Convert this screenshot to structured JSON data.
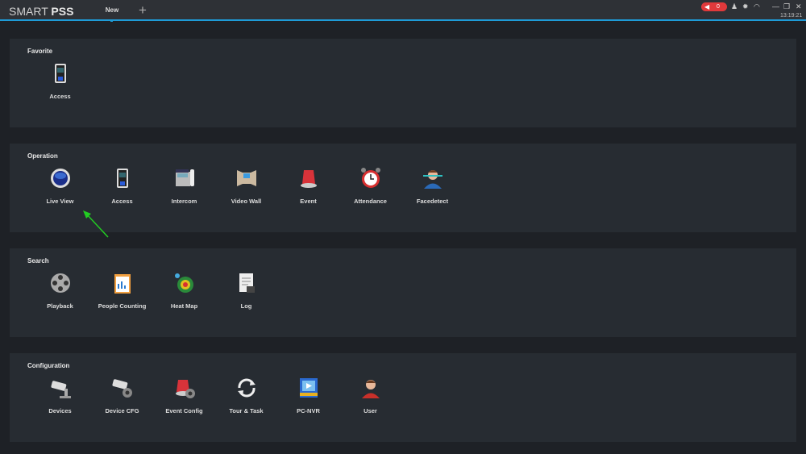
{
  "app": {
    "title_plain": "SMART ",
    "title_bold": "PSS",
    "tab": "New",
    "add_tab": "+",
    "alarm_count": "0",
    "time": "13:19:21"
  },
  "colors": {
    "accent": "#1e9bd7",
    "alarm": "#e0393b",
    "panel": "#272c32",
    "background": "#1e2126"
  },
  "sections": [
    {
      "title": "Favorite",
      "items": [
        {
          "label": "Access",
          "icon": "access"
        }
      ]
    },
    {
      "title": "Operation",
      "items": [
        {
          "label": "Live View",
          "icon": "liveview"
        },
        {
          "label": "Access",
          "icon": "access"
        },
        {
          "label": "Intercom",
          "icon": "intercom"
        },
        {
          "label": "Video Wall",
          "icon": "videowall"
        },
        {
          "label": "Event",
          "icon": "event"
        },
        {
          "label": "Attendance",
          "icon": "attendance"
        },
        {
          "label": "Facedetect",
          "icon": "facedetect"
        }
      ]
    },
    {
      "title": "Search",
      "items": [
        {
          "label": "Playback",
          "icon": "playback"
        },
        {
          "label": "People Counting",
          "icon": "peoplecounting"
        },
        {
          "label": "Heat Map",
          "icon": "heatmap"
        },
        {
          "label": "Log",
          "icon": "log"
        }
      ]
    },
    {
      "title": "Configuration",
      "items": [
        {
          "label": "Devices",
          "icon": "devices"
        },
        {
          "label": "Device CFG",
          "icon": "devicecfg"
        },
        {
          "label": "Event Config",
          "icon": "eventconfig"
        },
        {
          "label": "Tour & Task",
          "icon": "tourtask"
        },
        {
          "label": "PC-NVR",
          "icon": "pcnvr"
        },
        {
          "label": "User",
          "icon": "user"
        }
      ]
    }
  ]
}
